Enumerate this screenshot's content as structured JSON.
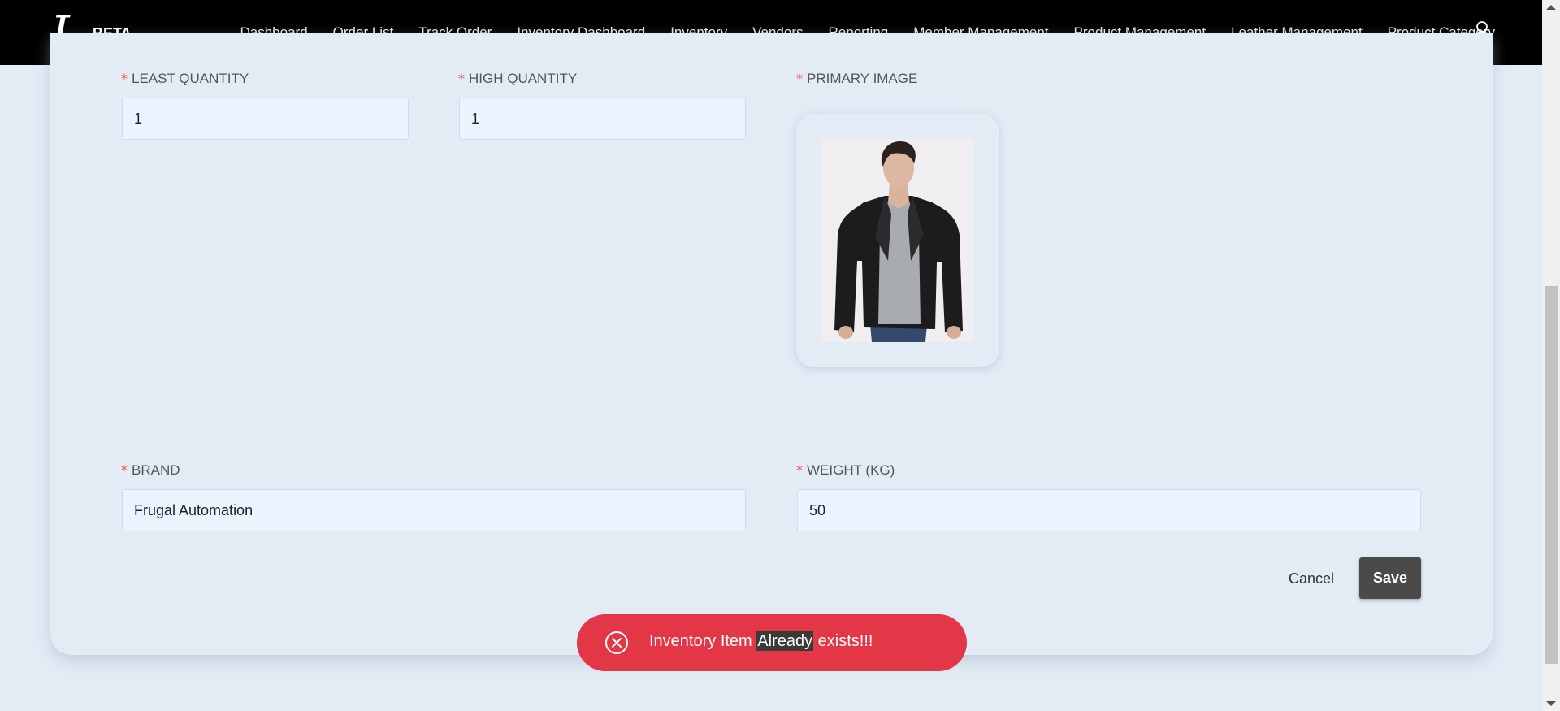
{
  "app": {
    "logo_letter": "L",
    "beta_label": "BETA"
  },
  "nav": {
    "items": [
      "Dashboard",
      "Order List",
      "Track Order",
      "Inventory Dashboard",
      "Inventory",
      "Vendors",
      "Reporting",
      "Member Management",
      "Product Management",
      "Leather Management",
      "Product Category"
    ],
    "user_icon": "user-icon"
  },
  "form": {
    "required_mark": "*",
    "least_quantity": {
      "label": "LEAST QUANTITY",
      "value": "1"
    },
    "high_quantity": {
      "label": "HIGH QUANTITY",
      "value": "1"
    },
    "primary_image": {
      "label": "PRIMARY IMAGE"
    },
    "brand": {
      "label": "BRAND",
      "value": "Frugal Automation"
    },
    "weight": {
      "label": "WEIGHT (KG)",
      "value": "50"
    }
  },
  "actions": {
    "cancel_label": "Cancel",
    "save_label": "Save"
  },
  "toast": {
    "icon": "close-circle-icon",
    "text_before": "Inventory Item ",
    "text_highlight": "Already",
    "text_after": " exists!!!",
    "color": "#e33747"
  }
}
